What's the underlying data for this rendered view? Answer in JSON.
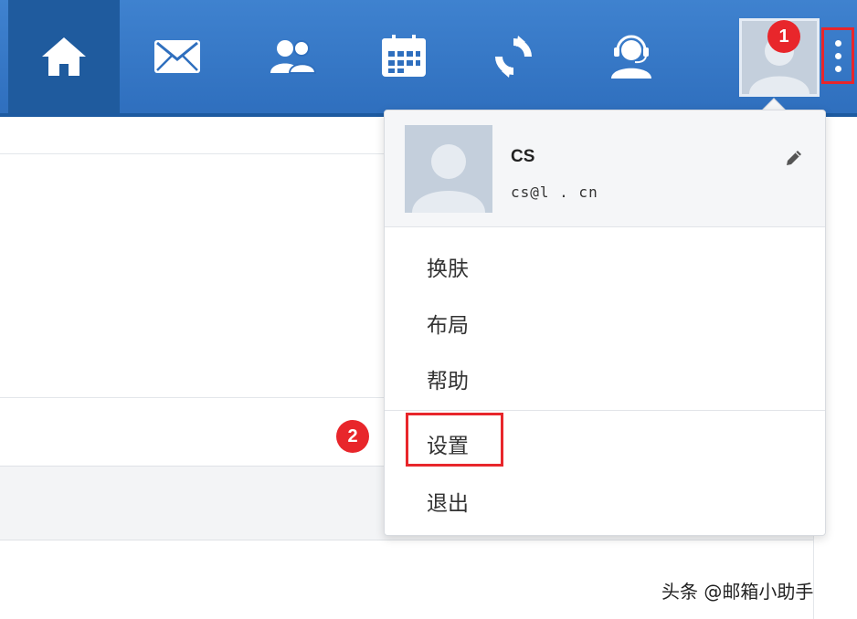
{
  "nav": {
    "items": [
      {
        "icon": "home-icon"
      },
      {
        "icon": "mail-icon"
      },
      {
        "icon": "contacts-icon"
      },
      {
        "icon": "calendar-icon"
      },
      {
        "icon": "sync-icon"
      },
      {
        "icon": "support-agent-icon"
      }
    ],
    "avatar_icon": "avatar-icon",
    "more_icon": "more-vertical-icon"
  },
  "annotations": {
    "badge_1": "1",
    "badge_2": "2"
  },
  "dropdown": {
    "user_name": "CS",
    "user_email": "cs@l          . cn",
    "edit_icon": "pencil-icon",
    "menu": {
      "skin": "换肤",
      "layout": "布局",
      "help": "帮助",
      "settings": "设置",
      "logout": "退出"
    }
  },
  "watermark": "头条 @邮箱小助手",
  "colors": {
    "topbar": "#3a7bc8",
    "topbar_active": "#1f5b9e",
    "annotation_red": "#e8262b"
  }
}
